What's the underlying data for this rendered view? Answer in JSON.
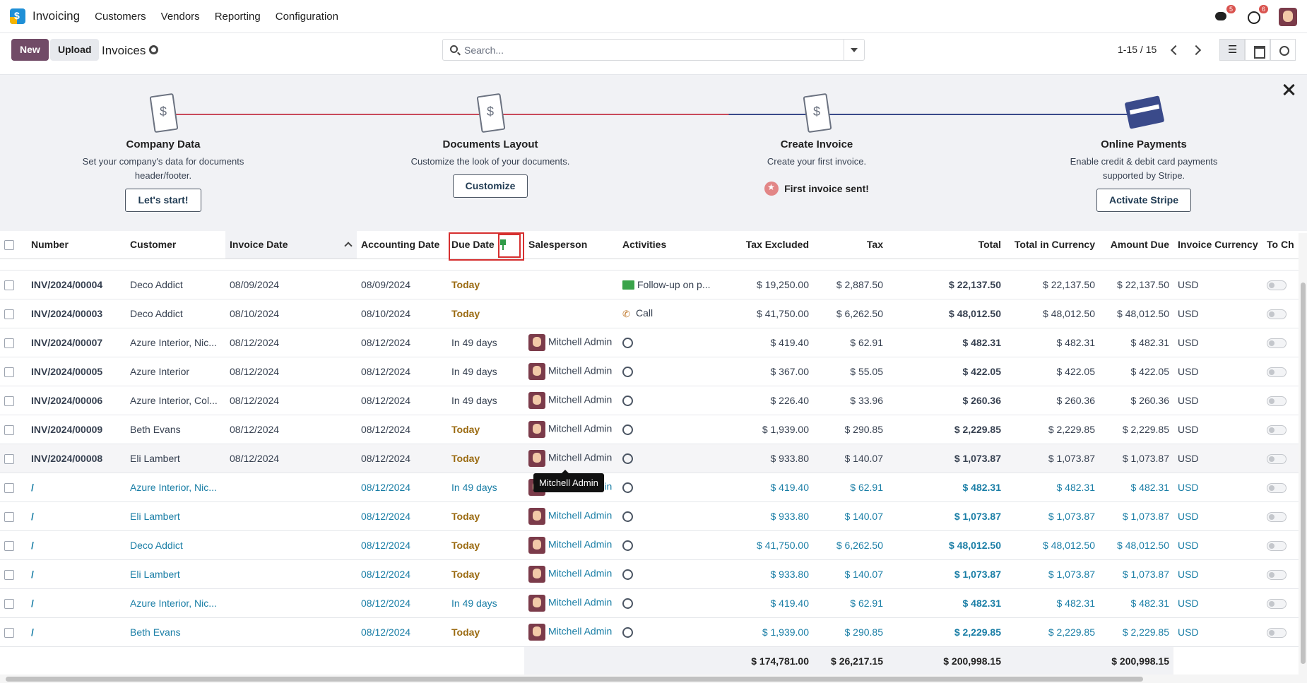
{
  "navbar": {
    "app_name": "Invoicing",
    "menu": [
      "Customers",
      "Vendors",
      "Reporting",
      "Configuration"
    ],
    "messages_badge": "5",
    "activities_badge": "6"
  },
  "control": {
    "new_label": "New",
    "upload_label": "Upload",
    "breadcrumb": "Invoices",
    "search_placeholder": "Search...",
    "pager": "1-15 / 15"
  },
  "onboarding": {
    "steps": [
      {
        "title": "Company Data",
        "desc": "Set your company's data for documents header/footer.",
        "button": "Let's start!"
      },
      {
        "title": "Documents Layout",
        "desc": "Customize the look of your documents.",
        "button": "Customize"
      },
      {
        "title": "Create Invoice",
        "desc": "Create your first invoice.",
        "done_text": "First invoice sent!"
      },
      {
        "title": "Online Payments",
        "desc": "Enable credit & debit card payments supported by Stripe.",
        "button": "Activate Stripe"
      }
    ]
  },
  "table": {
    "columns": [
      "Number",
      "Customer",
      "Invoice Date",
      "Accounting Date",
      "Due Date",
      "Salesperson",
      "Activities",
      "Tax Excluded",
      "Tax",
      "Total",
      "Total in Currency",
      "Amount Due",
      "Invoice Currency",
      "To Ch"
    ],
    "rows": [
      {
        "number": "INV/2024/00004",
        "customer": "Deco Addict",
        "invoice_date": "08/09/2024",
        "accounting_date": "08/09/2024",
        "due": "Today",
        "salesperson": "",
        "activity": "Follow-up on p...",
        "activity_type": "followup",
        "tax_excluded": "$ 19,250.00",
        "tax": "$ 2,887.50",
        "total": "$ 22,137.50",
        "total_currency": "$ 22,137.50",
        "amount_due": "$ 22,137.50",
        "currency": "USD",
        "draft": false
      },
      {
        "number": "INV/2024/00003",
        "customer": "Deco Addict",
        "invoice_date": "08/10/2024",
        "accounting_date": "08/10/2024",
        "due": "Today",
        "salesperson": "",
        "activity": "Call",
        "activity_type": "call",
        "tax_excluded": "$ 41,750.00",
        "tax": "$ 6,262.50",
        "total": "$ 48,012.50",
        "total_currency": "$ 48,012.50",
        "amount_due": "$ 48,012.50",
        "currency": "USD",
        "draft": false
      },
      {
        "number": "INV/2024/00007",
        "customer": "Azure Interior, Nic...",
        "invoice_date": "08/12/2024",
        "accounting_date": "08/12/2024",
        "due": "In 49 days",
        "salesperson": "Mitchell Admin",
        "activity": "",
        "activity_type": "clock",
        "tax_excluded": "$ 419.40",
        "tax": "$ 62.91",
        "total": "$ 482.31",
        "total_currency": "$ 482.31",
        "amount_due": "$ 482.31",
        "currency": "USD",
        "draft": false
      },
      {
        "number": "INV/2024/00005",
        "customer": "Azure Interior",
        "invoice_date": "08/12/2024",
        "accounting_date": "08/12/2024",
        "due": "In 49 days",
        "salesperson": "Mitchell Admin",
        "activity": "",
        "activity_type": "clock",
        "tax_excluded": "$ 367.00",
        "tax": "$ 55.05",
        "total": "$ 422.05",
        "total_currency": "$ 422.05",
        "amount_due": "$ 422.05",
        "currency": "USD",
        "draft": false
      },
      {
        "number": "INV/2024/00006",
        "customer": "Azure Interior, Col...",
        "invoice_date": "08/12/2024",
        "accounting_date": "08/12/2024",
        "due": "In 49 days",
        "salesperson": "Mitchell Admin",
        "activity": "",
        "activity_type": "clock",
        "tax_excluded": "$ 226.40",
        "tax": "$ 33.96",
        "total": "$ 260.36",
        "total_currency": "$ 260.36",
        "amount_due": "$ 260.36",
        "currency": "USD",
        "draft": false
      },
      {
        "number": "INV/2024/00009",
        "customer": "Beth Evans",
        "invoice_date": "08/12/2024",
        "accounting_date": "08/12/2024",
        "due": "Today",
        "salesperson": "Mitchell Admin",
        "activity": "",
        "activity_type": "clock",
        "tax_excluded": "$ 1,939.00",
        "tax": "$ 290.85",
        "total": "$ 2,229.85",
        "total_currency": "$ 2,229.85",
        "amount_due": "$ 2,229.85",
        "currency": "USD",
        "draft": false
      },
      {
        "number": "INV/2024/00008",
        "customer": "Eli Lambert",
        "invoice_date": "08/12/2024",
        "accounting_date": "08/12/2024",
        "due": "Today",
        "salesperson": "Mitchell Admin",
        "activity": "",
        "activity_type": "clock",
        "tax_excluded": "$ 933.80",
        "tax": "$ 140.07",
        "total": "$ 1,073.87",
        "total_currency": "$ 1,073.87",
        "amount_due": "$ 1,073.87",
        "currency": "USD",
        "draft": false
      },
      {
        "number": "/",
        "customer": "Azure Interior, Nic...",
        "invoice_date": "",
        "accounting_date": "08/12/2024",
        "due": "In 49 days",
        "salesperson": "Mitchell Admin",
        "activity": "",
        "activity_type": "clock",
        "tax_excluded": "$ 419.40",
        "tax": "$ 62.91",
        "total": "$ 482.31",
        "total_currency": "$ 482.31",
        "amount_due": "$ 482.31",
        "currency": "USD",
        "draft": true
      },
      {
        "number": "/",
        "customer": "Eli Lambert",
        "invoice_date": "",
        "accounting_date": "08/12/2024",
        "due": "Today",
        "salesperson": "Mitchell Admin",
        "activity": "",
        "activity_type": "clock",
        "tax_excluded": "$ 933.80",
        "tax": "$ 140.07",
        "total": "$ 1,073.87",
        "total_currency": "$ 1,073.87",
        "amount_due": "$ 1,073.87",
        "currency": "USD",
        "draft": true
      },
      {
        "number": "/",
        "customer": "Deco Addict",
        "invoice_date": "",
        "accounting_date": "08/12/2024",
        "due": "Today",
        "salesperson": "Mitchell Admin",
        "activity": "",
        "activity_type": "clock",
        "tax_excluded": "$ 41,750.00",
        "tax": "$ 6,262.50",
        "total": "$ 48,012.50",
        "total_currency": "$ 48,012.50",
        "amount_due": "$ 48,012.50",
        "currency": "USD",
        "draft": true
      },
      {
        "number": "/",
        "customer": "Eli Lambert",
        "invoice_date": "",
        "accounting_date": "08/12/2024",
        "due": "Today",
        "salesperson": "Mitchell Admin",
        "activity": "",
        "activity_type": "clock",
        "tax_excluded": "$ 933.80",
        "tax": "$ 140.07",
        "total": "$ 1,073.87",
        "total_currency": "$ 1,073.87",
        "amount_due": "$ 1,073.87",
        "currency": "USD",
        "draft": true
      },
      {
        "number": "/",
        "customer": "Azure Interior, Nic...",
        "invoice_date": "",
        "accounting_date": "08/12/2024",
        "due": "In 49 days",
        "salesperson": "Mitchell Admin",
        "activity": "",
        "activity_type": "clock",
        "tax_excluded": "$ 419.40",
        "tax": "$ 62.91",
        "total": "$ 482.31",
        "total_currency": "$ 482.31",
        "amount_due": "$ 482.31",
        "currency": "USD",
        "draft": true
      },
      {
        "number": "/",
        "customer": "Beth Evans",
        "invoice_date": "",
        "accounting_date": "08/12/2024",
        "due": "Today",
        "salesperson": "Mitchell Admin",
        "activity": "",
        "activity_type": "clock",
        "tax_excluded": "$ 1,939.00",
        "tax": "$ 290.85",
        "total": "$ 2,229.85",
        "total_currency": "$ 2,229.85",
        "amount_due": "$ 2,229.85",
        "currency": "USD",
        "draft": true
      }
    ],
    "totals": {
      "tax_excluded": "$ 174,781.00",
      "tax": "$ 26,217.15",
      "total": "$ 200,998.15",
      "amount_due": "$ 200,998.15"
    }
  },
  "tooltip": "Mitchell Admin",
  "colors": {
    "brand": "#714b67",
    "draft_text": "#1a7ea6",
    "due_text": "#9b6b12",
    "highlight": "#d62f2f"
  }
}
